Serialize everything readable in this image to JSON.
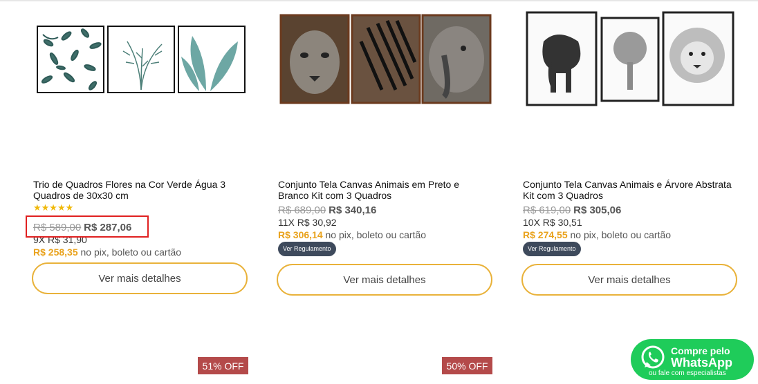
{
  "products": [
    {
      "title": "Trio de Quadros Flores na Cor Verde Água 3 Quadros de 30x30 cm",
      "rating": 5,
      "stars_text": "★★★★★",
      "old_price": "R$ 589,00",
      "new_price": "R$ 287,06",
      "installments": "9X R$ 31,90",
      "pix_price": "R$ 258,35",
      "pix_text": "no pix, boleto ou cartão",
      "button_label": "Ver mais detalhes"
    },
    {
      "title": "Conjunto Tela Canvas Animais em Preto e Branco Kit com 3 Quadros",
      "old_price": "R$ 689,00",
      "new_price": "R$ 340,16",
      "installments": "11X R$ 30,92",
      "pix_price": "R$ 306,14",
      "pix_text": "no pix, boleto ou cartão",
      "badge": "Ver Regulamento",
      "button_label": "Ver mais detalhes"
    },
    {
      "title": "Conjunto Tela Canvas Animais e Árvore Abstrata Kit com 3 Quadros",
      "old_price": "R$ 619,00",
      "new_price": "R$ 305,06",
      "installments": "10X R$ 30,51",
      "pix_price": "R$ 274,55",
      "pix_text": "no pix, boleto ou cartão",
      "badge": "Ver Regulamento",
      "button_label": "Ver mais detalhes"
    }
  ],
  "discount_badges": [
    "51% OFF",
    "50% OFF"
  ],
  "whatsapp": {
    "line1": "Compre pelo",
    "line2": "WhatsApp",
    "line3": "ou fale com especialistas"
  },
  "colors": {
    "accent_yellow": "#e9b23a",
    "pix_orange": "#e9a21c",
    "badge_dark": "#3e4a5c",
    "off_red": "#b44a4a",
    "whatsapp_green": "#1fcc5a",
    "highlight_red": "#e02020"
  }
}
